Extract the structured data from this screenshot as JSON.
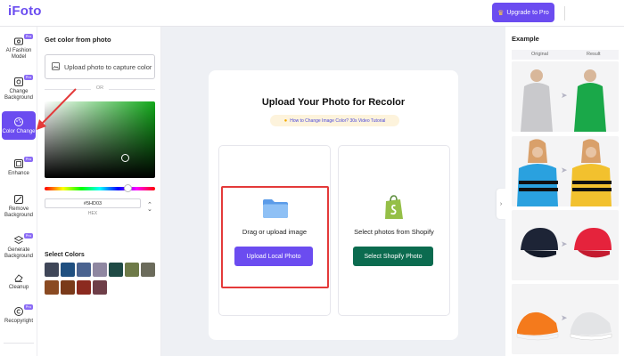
{
  "app": {
    "logo": "iFoto",
    "upgrade_label": "Upgrade to Pro",
    "upgrade_icon": "crown-icon"
  },
  "nav": {
    "items": [
      {
        "label": "AI Fashion Model",
        "icon": "hanger-icon",
        "pro": true
      },
      {
        "label": "Change Background",
        "icon": "background-icon",
        "pro": true
      },
      {
        "label": "Color Change",
        "icon": "palette-icon",
        "pro": false,
        "active": true
      },
      {
        "label": "Enhance",
        "icon": "enhance-icon",
        "pro": true
      },
      {
        "label": "Remove Background",
        "icon": "remove-bg-icon",
        "pro": false
      },
      {
        "label": "Generate Background",
        "icon": "layers-icon",
        "pro": true
      },
      {
        "label": "Cleanup",
        "icon": "eraser-icon",
        "pro": false
      },
      {
        "label": "Recopyright",
        "icon": "copyright-icon",
        "pro": true
      }
    ],
    "pro_badge": "Pro"
  },
  "color_panel": {
    "title": "Get color from photo",
    "upload_capture": "Upload photo to capture color",
    "or": "OR",
    "hex_value": "#5HD03",
    "hex_label": "HEX",
    "select_colors": "Select Colors",
    "swatches": [
      "#3f4658",
      "#1f4f80",
      "#4a6390",
      "#8f87a1",
      "#1f4a45",
      "#6e7a48",
      "#6b6b5b",
      "#8a4a22",
      "#7a3a1a",
      "#8b2a1f",
      "#6e3e48"
    ]
  },
  "upload": {
    "title": "Upload Your Photo for Recolor",
    "tutorial": "How to Change Image Color? 30s Video Tutorial",
    "left_label": "Drag or upload image",
    "left_button": "Upload Local Photo",
    "right_label": "Select photos from Shopify",
    "right_button": "Select Shopify Photo"
  },
  "example": {
    "title": "Example",
    "original": "Original",
    "result": "Result"
  }
}
